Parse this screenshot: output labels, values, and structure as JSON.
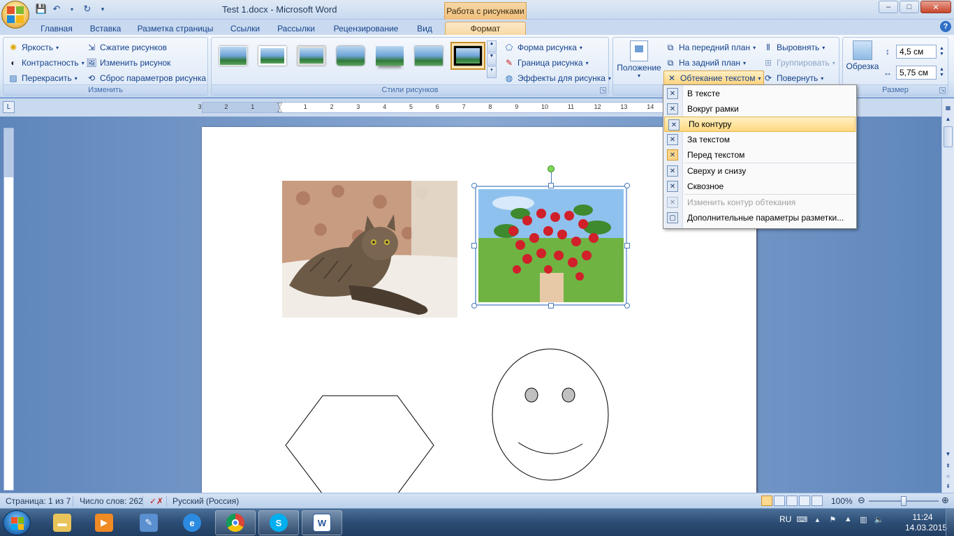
{
  "window": {
    "title": "Test 1.docx - Microsoft Word",
    "context_tab_title": "Работа с рисунками",
    "controls": {
      "minimize": "–",
      "maximize": "□",
      "close": "✕"
    }
  },
  "qat": {
    "save_icon": "save-icon",
    "undo_icon": "undo-icon",
    "redo_icon": "redo-icon"
  },
  "tabs": [
    {
      "label": "Главная"
    },
    {
      "label": "Вставка"
    },
    {
      "label": "Разметка страницы"
    },
    {
      "label": "Ссылки"
    },
    {
      "label": "Рассылки"
    },
    {
      "label": "Рецензирование"
    },
    {
      "label": "Вид"
    },
    {
      "label": "Формат",
      "active": true
    }
  ],
  "ribbon": {
    "adjust": {
      "label": "Изменить",
      "brightness": "Яркость",
      "contrast": "Контрастность",
      "recolor": "Перекрасить",
      "compress": "Сжатие рисунков",
      "change": "Изменить рисунок",
      "reset": "Сброс параметров рисунка"
    },
    "styles": {
      "label": "Стили рисунков",
      "shape": "Форма рисунка",
      "border": "Граница рисунка",
      "effects": "Эффекты для рисунка"
    },
    "arrange": {
      "position": "Положение",
      "bring_front": "На передний план",
      "send_back": "На задний план",
      "wrap": "Обтекание текстом",
      "align": "Выровнять",
      "group": "Группировать",
      "rotate": "Повернуть"
    },
    "size": {
      "label": "Размер",
      "crop": "Обрезка",
      "height": "4,5 см",
      "width": "5,75 см"
    }
  },
  "ruler": {
    "numbers": [
      "3",
      "2",
      "1",
      "1",
      "2",
      "3",
      "4",
      "5",
      "6",
      "7",
      "8",
      "9",
      "10",
      "11",
      "12",
      "13",
      "14"
    ]
  },
  "wrap_menu": {
    "items": [
      {
        "label": "В тексте",
        "key": "inline"
      },
      {
        "label": "Вокруг рамки",
        "key": "square"
      },
      {
        "label": "По контуру",
        "key": "tight",
        "highlighted": true
      },
      {
        "label": "За текстом",
        "key": "behind"
      },
      {
        "label": "Перед текстом",
        "key": "front",
        "checked": true
      },
      {
        "label": "Сверху и снизу",
        "key": "topbottom"
      },
      {
        "label": "Сквозное",
        "key": "through"
      },
      {
        "label": "Изменить контур обтекания",
        "key": "edit",
        "disabled": true
      },
      {
        "label": "Дополнительные параметры разметки...",
        "key": "more"
      }
    ]
  },
  "status": {
    "page": "Страница: 1 из 7",
    "words": "Число слов: 262",
    "language": "Русский (Россия)",
    "zoom": "100%",
    "zoom_fraction": 0.5
  },
  "taskbar": {
    "apps": [
      "explorer",
      "media-player",
      "paint",
      "internet-explorer",
      "chrome",
      "skype",
      "word"
    ],
    "tray_lang": "RU",
    "time": "11:24",
    "date": "14.03.2015"
  },
  "colors": {
    "accent": "#f7d9a5",
    "ribbon": "#dfeaf7",
    "taskbar": "#2c4d74"
  }
}
